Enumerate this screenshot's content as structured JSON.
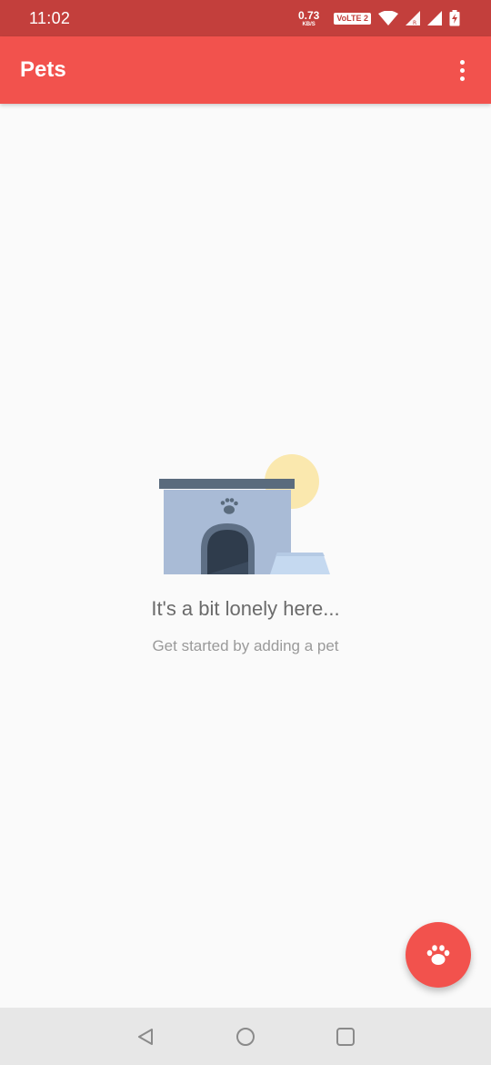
{
  "status_bar": {
    "time": "11:02",
    "net_speed_value": "0.73",
    "net_speed_unit": "KB/S",
    "volte_label": "VoLTE 2",
    "icons": [
      "wifi-icon",
      "signal-r-icon",
      "signal-icon",
      "battery-charging-icon"
    ]
  },
  "app_bar": {
    "title": "Pets",
    "menu_icon": "more-vert-icon"
  },
  "empty_state": {
    "title": "It's a bit lonely here...",
    "subtitle": "Get started by adding a pet",
    "illustration": "dog-house-illustration"
  },
  "fab": {
    "icon": "paw-icon"
  },
  "nav_bar": {
    "buttons": [
      "back-icon",
      "home-icon",
      "recents-icon"
    ]
  },
  "colors": {
    "status_bar": "#c33f3c",
    "primary": "#f2524d",
    "background": "#fafafa",
    "nav_bar": "#e7e7e7"
  }
}
